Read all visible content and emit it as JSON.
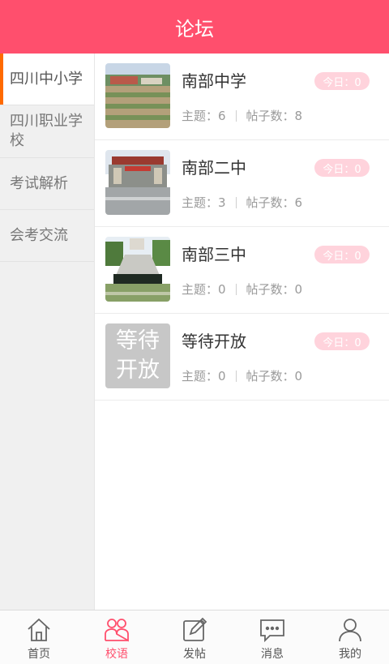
{
  "header": {
    "title": "论坛"
  },
  "sidebar": {
    "items": [
      {
        "label": "四川中小学"
      },
      {
        "label": "四川职业学校"
      },
      {
        "label": "考试解析"
      },
      {
        "label": "会考交流"
      }
    ]
  },
  "forums": [
    {
      "title": "南部中学",
      "badge": "今日：0",
      "topics": "主题：6",
      "posts": "帖子数：8",
      "thumb": "school-photo-1"
    },
    {
      "title": "南部二中",
      "badge": "今日：0",
      "topics": "主题：3",
      "posts": "帖子数：6",
      "thumb": "school-photo-2"
    },
    {
      "title": "南部三中",
      "badge": "今日：0",
      "topics": "主题：0",
      "posts": "帖子数：0",
      "thumb": "school-photo-3"
    },
    {
      "title": "等待开放",
      "badge": "今日：0",
      "topics": "主题：0",
      "posts": "帖子数：0",
      "thumb_text": "等待开放"
    }
  ],
  "bottom_nav": {
    "items": [
      {
        "label": "首页",
        "icon": "home-icon"
      },
      {
        "label": "校语",
        "icon": "people-icon"
      },
      {
        "label": "发帖",
        "icon": "edit-icon"
      },
      {
        "label": "消息",
        "icon": "message-icon"
      },
      {
        "label": "我的",
        "icon": "user-icon"
      }
    ]
  },
  "colors": {
    "accent": "#ff4f6d",
    "sidebar_active_marker": "#ff6a00",
    "badge_bg": "#ffd3dc"
  }
}
